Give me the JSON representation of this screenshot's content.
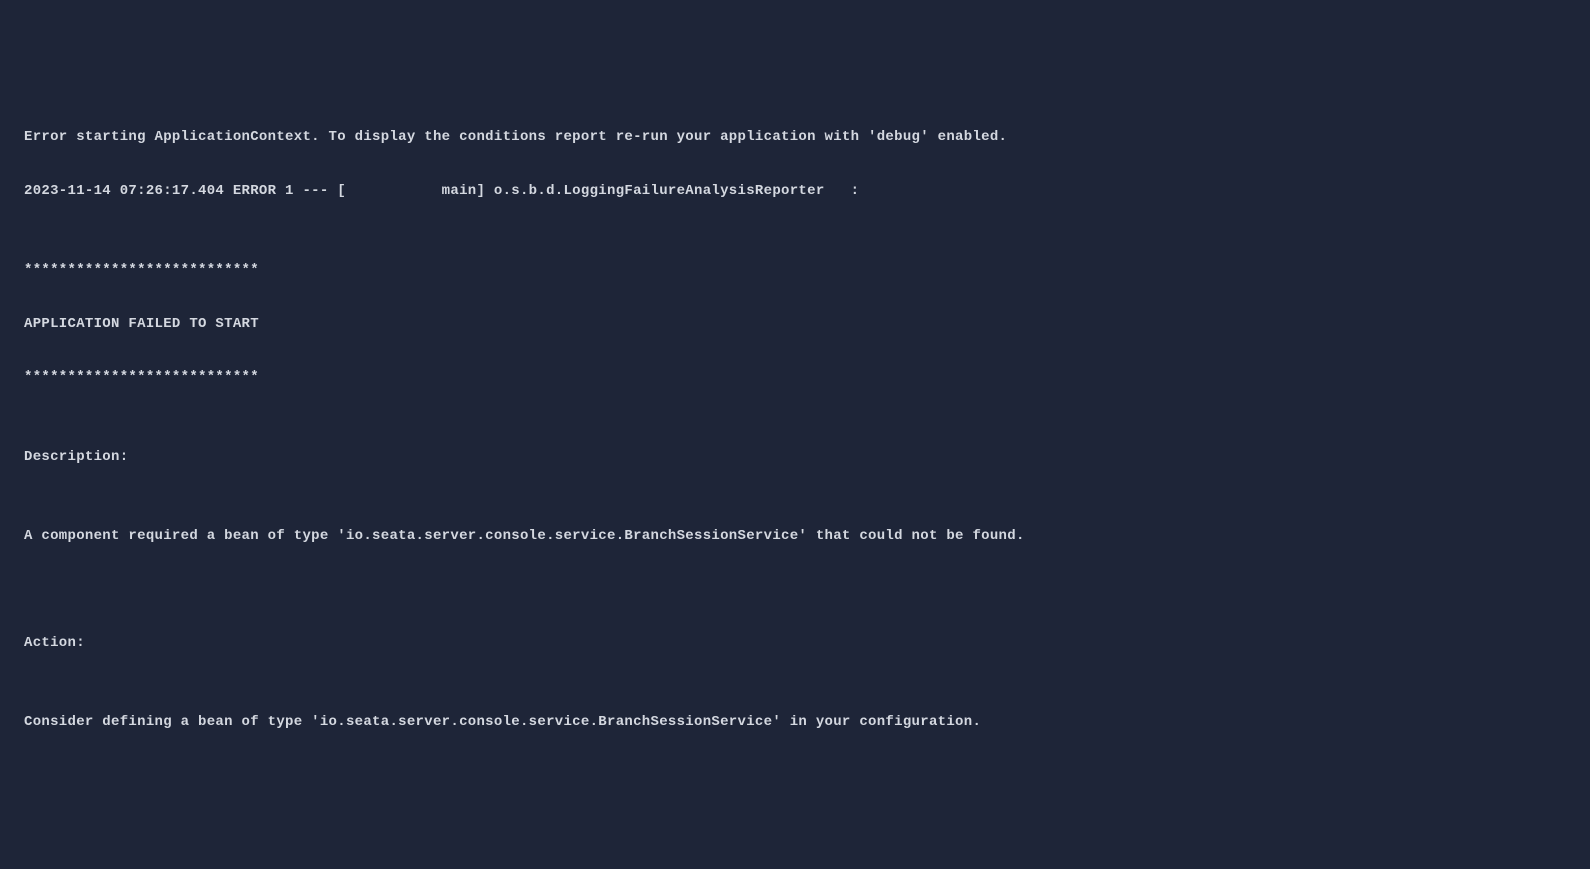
{
  "lines": {
    "l0": "Error starting ApplicationContext. To display the conditions report re-run your application with 'debug' enabled.",
    "l1": "2023-11-14 07:26:17.404 ERROR 1 --- [           main] o.s.b.d.LoggingFailureAnalysisReporter   :",
    "l2": "",
    "l3": "***************************",
    "l4": "APPLICATION FAILED TO START",
    "l5": "***************************",
    "l6": "",
    "l7": "Description:",
    "l8": "",
    "l9": "A component required a bean of type 'io.seata.server.console.service.BranchSessionService' that could not be found.",
    "l10": "",
    "l11": "",
    "l12": "Action:",
    "l13": "",
    "l14": "Consider defining a bean of type 'io.seata.server.console.service.BranchSessionService' in your configuration."
  }
}
